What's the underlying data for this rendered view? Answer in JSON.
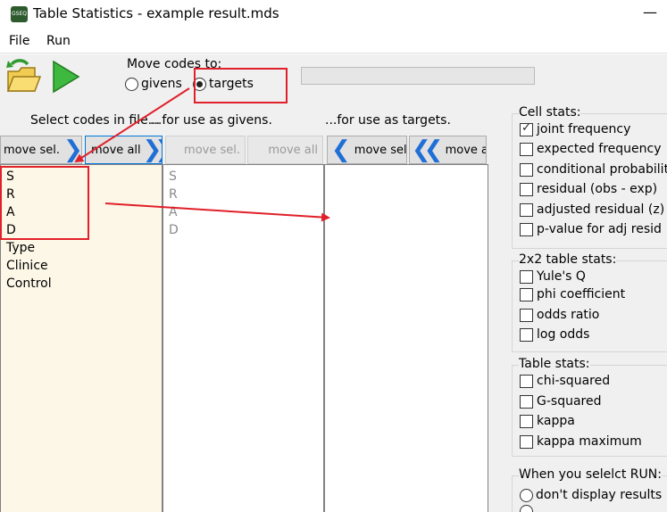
{
  "window": {
    "title": "Table Statistics - example result.mds",
    "icon_text": "GSEQ",
    "minimize_glyph": "—"
  },
  "menu": {
    "file": "File",
    "run": "Run"
  },
  "toolbar": {
    "move_group_title": "Move codes to:",
    "radio_givens": "givens",
    "radio_targets": "targets",
    "selected_radio": "targets"
  },
  "columns": {
    "file_header": "Select codes in file...",
    "givens_header": "...for use as givens.",
    "targets_header": "...for use as targets."
  },
  "buttons": {
    "file_move_sel": "move sel.",
    "file_move_all": "move all",
    "givens_move_sel": "move sel.",
    "givens_move_all": "move all",
    "targets_move_sel": "move sel.",
    "targets_move_all": "move all"
  },
  "lists": {
    "file_codes": [
      "S",
      "R",
      "A",
      "D",
      "Type",
      "Clinice",
      "Control"
    ],
    "givens_codes": [
      "S",
      "R",
      "A",
      "D"
    ],
    "targets_codes": []
  },
  "right_panel": {
    "cell_stats": {
      "title": "Cell stats:",
      "items": [
        {
          "label": "joint frequency",
          "checked": true
        },
        {
          "label": "expected frequency",
          "checked": false
        },
        {
          "label": "conditional probabilit",
          "checked": false
        },
        {
          "label": "residual (obs - exp)",
          "checked": false
        },
        {
          "label": "adjusted residual (z)",
          "checked": false
        },
        {
          "label": "p-value for adj resid",
          "checked": false
        }
      ]
    },
    "table2x2_stats": {
      "title": "2x2 table stats:",
      "items": [
        {
          "label": "Yule's Q",
          "checked": false
        },
        {
          "label": "phi coefficient",
          "checked": false
        },
        {
          "label": "odds ratio",
          "checked": false
        },
        {
          "label": "log odds",
          "checked": false
        }
      ]
    },
    "table_stats": {
      "title": "Table stats:",
      "items": [
        {
          "label": "chi-squared",
          "checked": false
        },
        {
          "label": "G-squared",
          "checked": false
        },
        {
          "label": "kappa",
          "checked": false
        },
        {
          "label": "kappa maximum",
          "checked": false
        }
      ]
    },
    "run_options": {
      "title": "When you selelct RUN:",
      "option1": "don't display results"
    }
  },
  "colors": {
    "accent": "#1f6fd6",
    "annotation": "#e0202a",
    "highlight_list": "#fdf7e7"
  }
}
